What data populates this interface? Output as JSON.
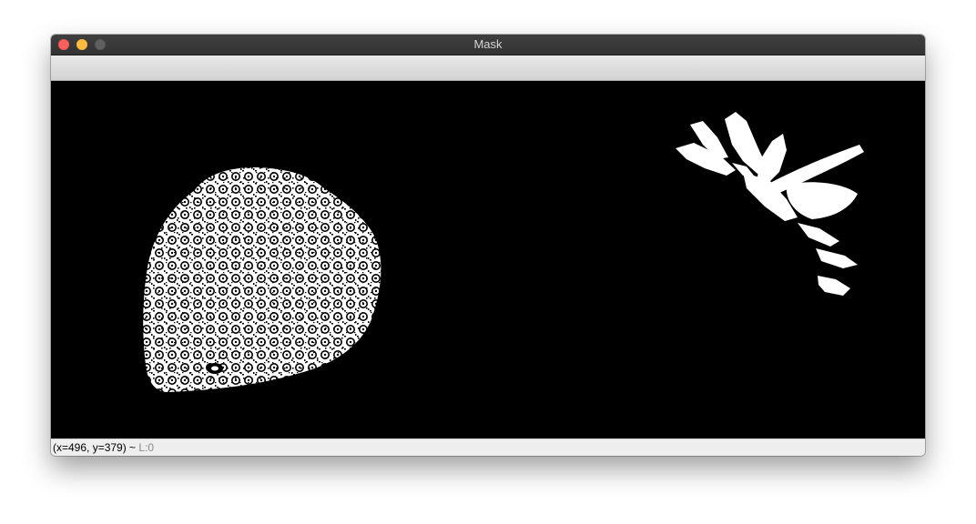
{
  "window": {
    "title": "Mask",
    "traffic_colors": {
      "close": "#fc605c",
      "minimize": "#fdbc40",
      "maximize": "#5f5f5f"
    }
  },
  "canvas": {
    "background": "#000000",
    "foreground": "#ffffff",
    "content": [
      "strawberry-mask",
      "leaves-mask"
    ]
  },
  "status": {
    "coords": "(x=496, y=379) ~",
    "level": "L:0"
  }
}
